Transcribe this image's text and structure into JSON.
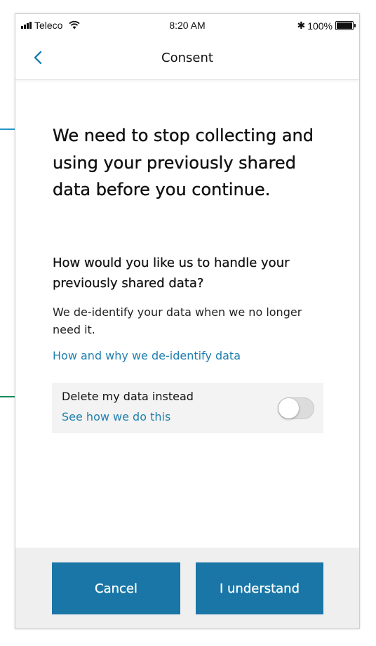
{
  "status_bar": {
    "carrier": "Teleco",
    "time": "8:20 AM",
    "battery": "100%",
    "bluetooth_icon": "bluetooth-icon",
    "wifi_icon": "wifi-icon",
    "battery_level": 1.0
  },
  "nav": {
    "title": "Consent",
    "back_icon": "chevron-left-icon"
  },
  "content": {
    "headline": "We need to stop collecting and using your previously shared data before you continue.",
    "subheading": "How would you like us to handle your previously shared data?",
    "body": "We de-identify your data when we no longer need it.",
    "link": "How and why we de-identify data",
    "toggle": {
      "label": "Delete my data instead",
      "link": "See how we do this",
      "on": false
    }
  },
  "footer": {
    "cancel_label": "Cancel",
    "confirm_label": "I understand"
  },
  "colors": {
    "accent": "#1976a6",
    "link": "#1f7fae",
    "annotation_blue": "#2596c8",
    "annotation_green": "#138a5a"
  }
}
